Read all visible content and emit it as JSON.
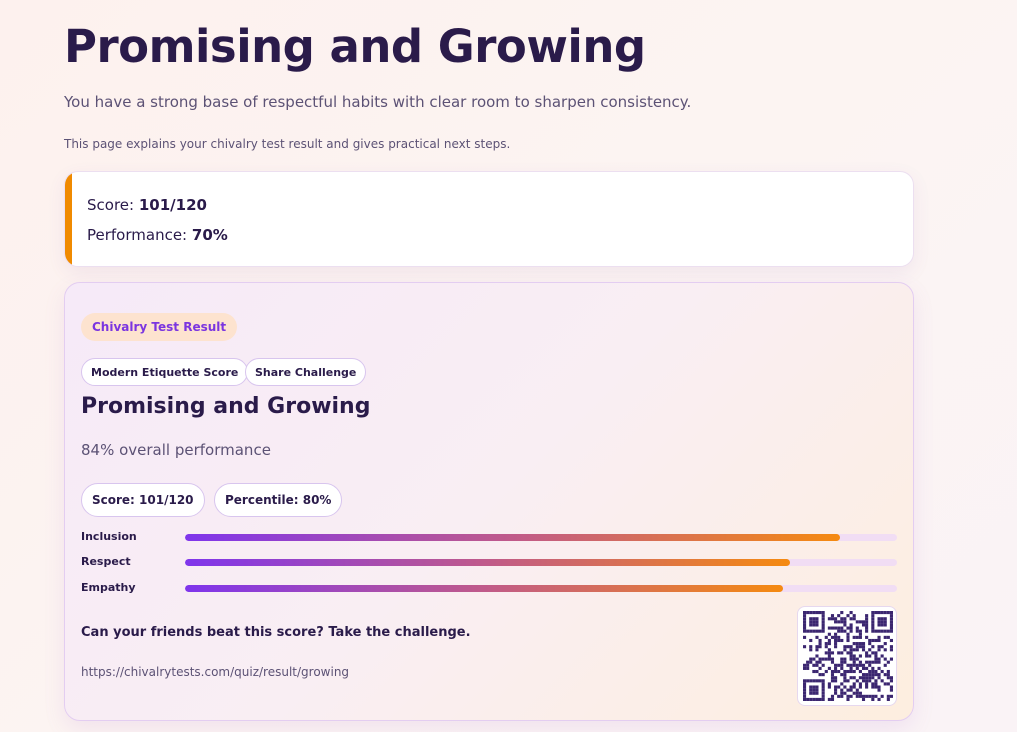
{
  "header": {
    "title": "Promising and Growing",
    "subtitle": "You have a strong base of respectful habits with clear room to sharpen consistency.",
    "explanation": "This page explains your chivalry test result and gives practical next steps."
  },
  "score_card": {
    "score_label": "Score: ",
    "score_value": "101/120",
    "performance_label": "Performance: ",
    "performance_value": "70%",
    "accent_color": "#f08a00"
  },
  "result_card": {
    "tag": "Chivalry Test Result",
    "chips": [
      "Modern Etiquette Score",
      "Share Challenge"
    ],
    "title": "Promising and Growing",
    "overall": "84% overall performance",
    "stats": [
      "Score: 101/120",
      "Percentile: 80%"
    ],
    "bars": [
      {
        "label": "Inclusion",
        "percent": 92
      },
      {
        "label": "Respect",
        "percent": 85
      },
      {
        "label": "Empathy",
        "percent": 84
      }
    ],
    "challenge_text": "Can your friends beat this score? Take the challenge.",
    "url": "https://chivalrytests.com/quiz/result/growing",
    "qr_icon": "qr-code-icon",
    "colors": {
      "tag_bg": "#fde3cf",
      "tag_text": "#7b35e0",
      "bar_start": "#7f35ec",
      "bar_end": "#f58a10",
      "qr_color": "#3b2670"
    }
  }
}
